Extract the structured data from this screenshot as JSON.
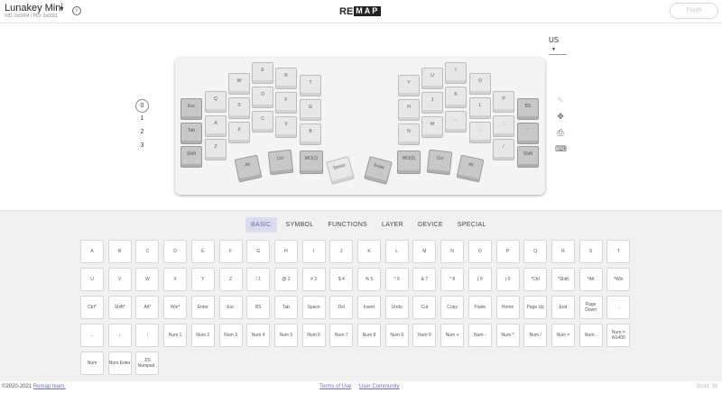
{
  "header": {
    "keyboard_name": "Lunakey Mini",
    "ids": "VID: 0x5954 / PID: 0x0001",
    "logo_re": "RE",
    "logo_map": "MAP",
    "flash_label": "Flash"
  },
  "layout_select": {
    "value": "US"
  },
  "layers": [
    "0",
    "1",
    "2",
    "3"
  ],
  "keyboard": {
    "keys": [
      "Esc",
      "Q",
      "W",
      "E",
      "R",
      "T",
      "Tab",
      "A",
      "S",
      "D",
      "F",
      "G",
      "Shift",
      "Z",
      "X",
      "C",
      "V",
      "B",
      "Alt",
      "Ctrl",
      "MO(1)",
      "Space",
      "Y",
      "U",
      "I",
      "O",
      "P",
      "BS",
      "H",
      "J",
      "K",
      "L",
      ";",
      "'",
      "N",
      "M",
      ",",
      ".",
      "/",
      "Shift",
      "Enter",
      "MO(2)",
      "Ctrl",
      "Alt"
    ]
  },
  "tabs": [
    "BASIC",
    "SYMBOL",
    "FUNCTIONS",
    "LAYER",
    "DEVICE",
    "SPECIAL"
  ],
  "palette": [
    [
      "A",
      "B",
      "C",
      "D",
      "E",
      "F",
      "G",
      "H",
      "I",
      "J",
      "K",
      "L",
      "M",
      "N",
      "O",
      "P",
      "Q",
      "R",
      "S",
      "T"
    ],
    [
      "U",
      "V",
      "W",
      "X",
      "Y",
      "Z",
      "! 1",
      "@ 2",
      "# 3",
      "$ 4",
      "% 5",
      "^ 6",
      "& 7",
      "* 8",
      "( 9",
      ") 0",
      "*Ctrl",
      "*Shift",
      "*Alt",
      "*Win"
    ],
    [
      "Ctrl*",
      "Shift*",
      "Alt*",
      "Win*",
      "Enter",
      "Esc",
      "BS",
      "Tab",
      "Space",
      "Del",
      "Insert",
      "Undo",
      "Cut",
      "Copy",
      "Paste",
      "Home",
      "Page Up",
      "End",
      "Page Down",
      "→"
    ],
    [
      "←",
      "↓",
      "↑",
      "Num 1",
      "Num 2",
      "Num 3",
      "Num 4",
      "Num 5",
      "Num 6",
      "Num 7",
      "Num 8",
      "Num 9",
      "Num 0",
      "Num +",
      "Num -",
      "Num *",
      "Num /",
      "Num =",
      "Num .",
      "Num = AS400"
    ],
    [
      "Num",
      "Num Enter",
      "JIS Numpad ,"
    ]
  ],
  "footer": {
    "copyright": "©2020-2021 ",
    "team_link": "Remap team.",
    "terms": "Terms of Use",
    "community": "User Community",
    "build": "Build: 38"
  }
}
